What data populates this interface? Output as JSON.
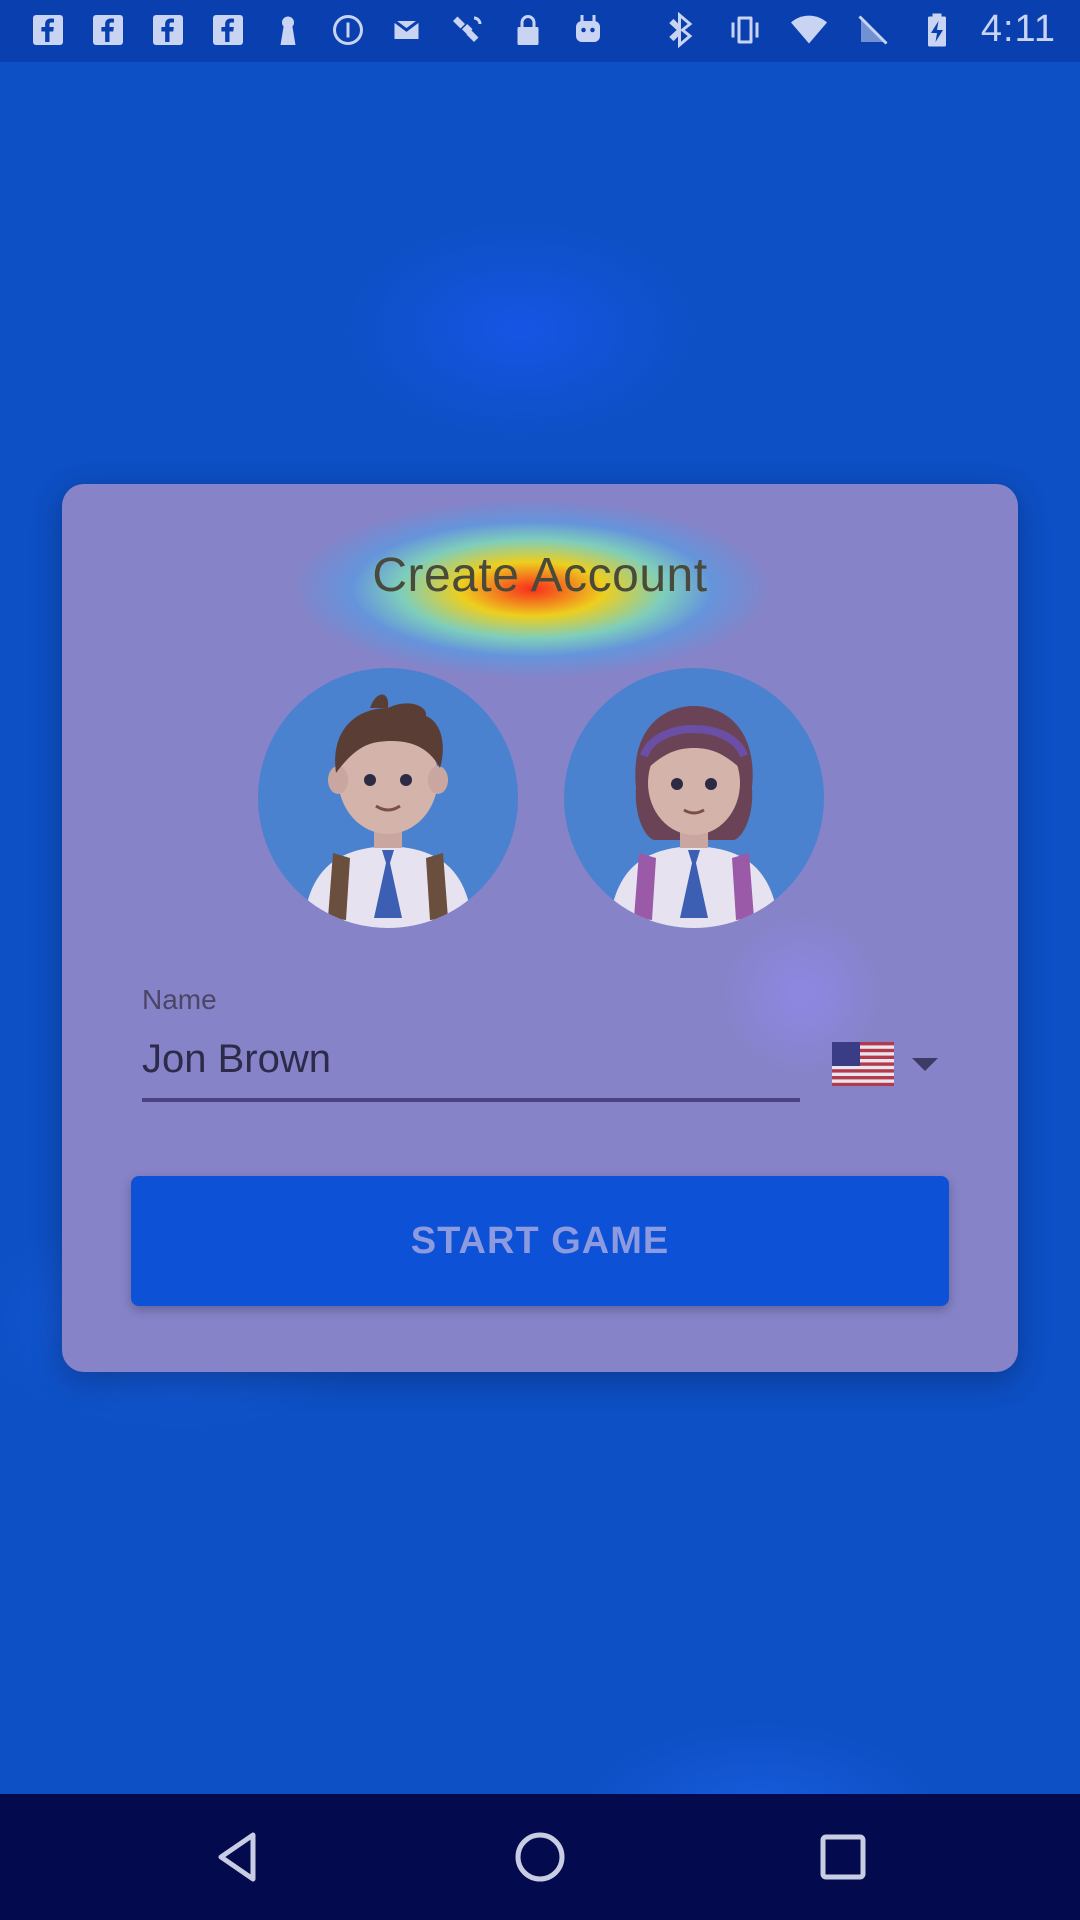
{
  "status_bar": {
    "time": "4:11",
    "left_icons": [
      "facebook-icon",
      "facebook-icon",
      "facebook-icon",
      "facebook-icon",
      "keyhole-icon",
      "info-circle-icon",
      "mail-icon",
      "satellite-icon",
      "lock-icon",
      "android-icon"
    ],
    "right_icons": [
      "bluetooth-icon",
      "vibrate-icon",
      "wifi-icon",
      "no-sim-icon",
      "battery-charging-icon"
    ]
  },
  "card": {
    "title": "Create Account",
    "avatars": [
      {
        "name": "boy-avatar"
      },
      {
        "name": "girl-avatar"
      }
    ],
    "name_field": {
      "label": "Name",
      "value": "Jon Brown",
      "placeholder": ""
    },
    "country_select": {
      "selected": "United States",
      "icon": "us-flag-icon"
    },
    "start_button": {
      "label": "START GAME"
    }
  },
  "nav_bar": {
    "buttons": [
      "back-icon",
      "home-icon",
      "recents-icon"
    ]
  },
  "colors": {
    "background": "#0d4fc4",
    "card": "#8683c8",
    "button": "#0d52d6",
    "nav_bar": "#030b4e"
  }
}
